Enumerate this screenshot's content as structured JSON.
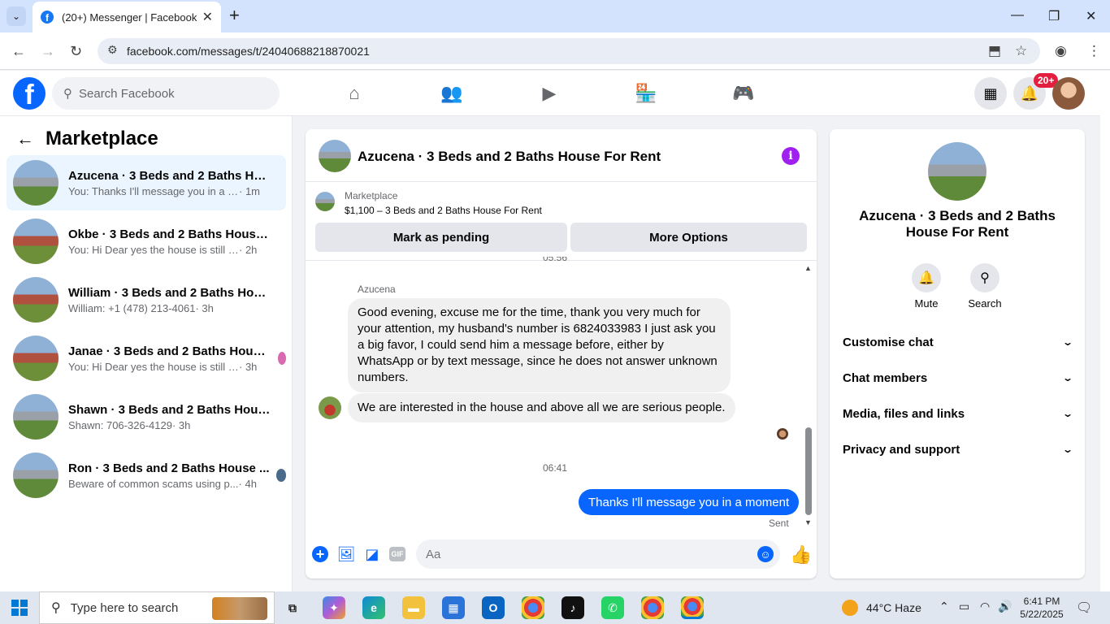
{
  "browser": {
    "tab_title": "(20+) Messenger | Facebook",
    "url": "facebook.com/messages/t/24040688218870021"
  },
  "fb": {
    "logo_letter": "f",
    "search_placeholder": "Search Facebook",
    "notification_count": "20+"
  },
  "sidebar": {
    "title": "Marketplace",
    "conversations": [
      {
        "name": "Azucena · 3 Beds and 2 Baths Hou...",
        "preview": "You: Thanks I'll message you in a mo...",
        "time": " · 1m",
        "active": true
      },
      {
        "name": "Okbe · 3 Beds and 2 Baths House ...",
        "preview": "You: Hi Dear yes the house is still avail...",
        "time": " · 2h"
      },
      {
        "name": "William · 3 Beds and 2 Baths Hous...",
        "preview": "William: +1 (478) 213-4061",
        "time": " · 3h"
      },
      {
        "name": "Janae · 3 Beds and 2 Baths House...",
        "preview": "You: Hi Dear yes the house is still a...",
        "time": " · 3h"
      },
      {
        "name": "Shawn · 3 Beds and 2 Baths House...",
        "preview": "Shawn: 706-326-4129",
        "time": " · 3h"
      },
      {
        "name": "Ron · 3 Beds and 2 Baths House ...",
        "preview": "Beware of common scams using p...",
        "time": " · 4h"
      }
    ]
  },
  "chat": {
    "title": "Azucena · 3 Beds and 2 Baths House For Rent",
    "marketplace_label": "Marketplace",
    "listing": "$1,100 – 3 Beds and 2 Baths House For Rent",
    "mark_pending": "Mark as pending",
    "more_options": "More Options",
    "cut_timestamp": "05:56",
    "sender": "Azucena",
    "message1": "Good evening, excuse me for the time, thank you very much for your attention, my husband's number is 6824033983 I just ask you a big favor, I could send him a message before, either by WhatsApp or by text message, since he does not answer unknown numbers.",
    "message2": "We are interested in the house and above all we are serious people.",
    "timestamp2": "06:41",
    "my_message": "Thanks I'll message you in a moment",
    "status": "Sent",
    "gif_label": "GIF",
    "composer_placeholder": "Aa"
  },
  "details": {
    "name": "Azucena · 3 Beds and 2 Baths House For Rent",
    "mute": "Mute",
    "search": "Search",
    "sections": [
      "Customise chat",
      "Chat members",
      "Media, files and links",
      "Privacy and support"
    ]
  },
  "taskbar": {
    "search_placeholder": "Type here to search",
    "weather": "44°C  Haze",
    "time": "6:41 PM",
    "date": "5/22/2025"
  }
}
